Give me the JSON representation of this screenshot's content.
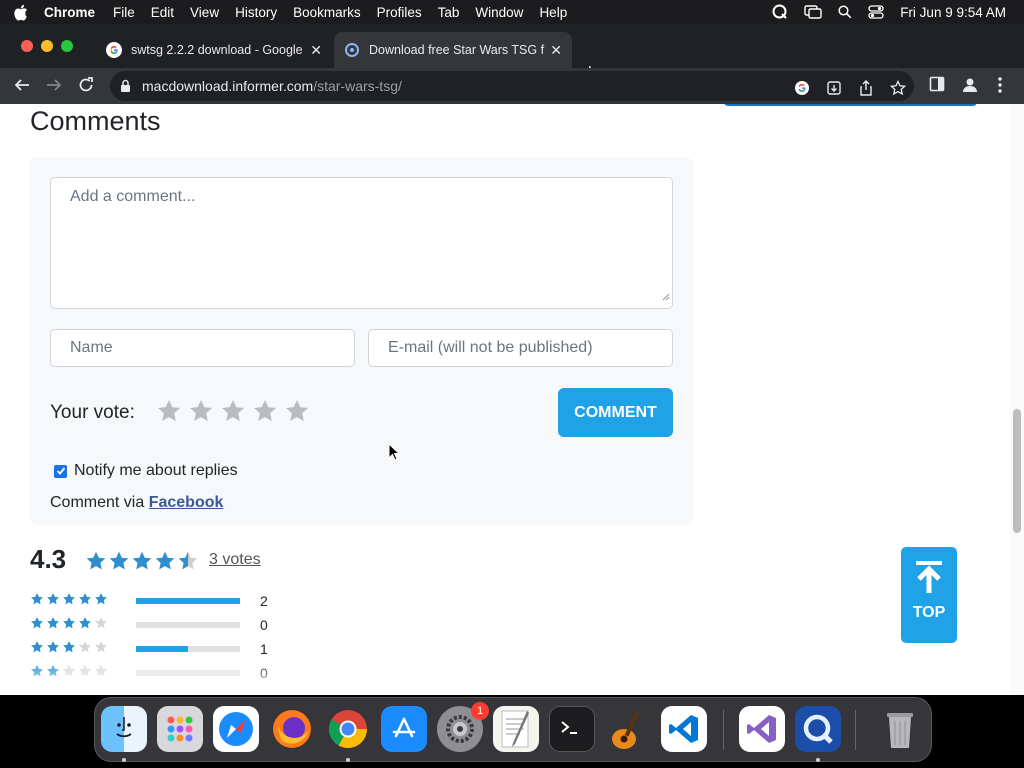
{
  "menubar": {
    "app": "Chrome",
    "items": [
      "File",
      "Edit",
      "View",
      "History",
      "Bookmarks",
      "Profiles",
      "Tab",
      "Window",
      "Help"
    ],
    "clock": "Fri Jun 9  9:54 AM"
  },
  "tabs": [
    {
      "title": "swtsg 2.2.2 download - Google",
      "active": false
    },
    {
      "title": "Download free Star Wars TSG f",
      "active": true
    }
  ],
  "address_bar": {
    "domain": "macdownload.informer.com",
    "path": "/star-wars-tsg/"
  },
  "comments": {
    "heading": "Comments",
    "comment_placeholder": "Add a comment...",
    "name_placeholder": "Name",
    "email_placeholder": "E-mail (will not be published)",
    "vote_label": "Your vote:",
    "submit_label": "COMMENT",
    "notify_label": "Notify me about replies",
    "notify_checked": true,
    "via_prefix": "Comment via ",
    "via_link": "Facebook"
  },
  "rating": {
    "score": "4.3",
    "votes_link": "3 votes",
    "distribution": [
      {
        "stars": 5,
        "count": "2",
        "fill": 1.0
      },
      {
        "stars": 4,
        "count": "0",
        "fill": 0.0
      },
      {
        "stars": 3,
        "count": "1",
        "fill": 0.5
      },
      {
        "stars": 2,
        "count": "0",
        "fill": 0.0
      }
    ]
  },
  "top_button": {
    "label": "TOP"
  },
  "dock": {
    "apps": [
      "finder-icon",
      "launchpad-icon",
      "safari-icon",
      "firefox-icon",
      "chrome-icon",
      "app-store-icon",
      "system-settings-icon",
      "textedit-icon",
      "terminal-icon",
      "garageband-icon",
      "vscode-icon",
      "visual-studio-icon",
      "quicktime-icon",
      "trash-icon"
    ],
    "settings_badge": "1"
  },
  "colors": {
    "accent": "#1fa2e6",
    "star_blue": "#2e8fcf",
    "star_grey": "#cfcfcf"
  }
}
